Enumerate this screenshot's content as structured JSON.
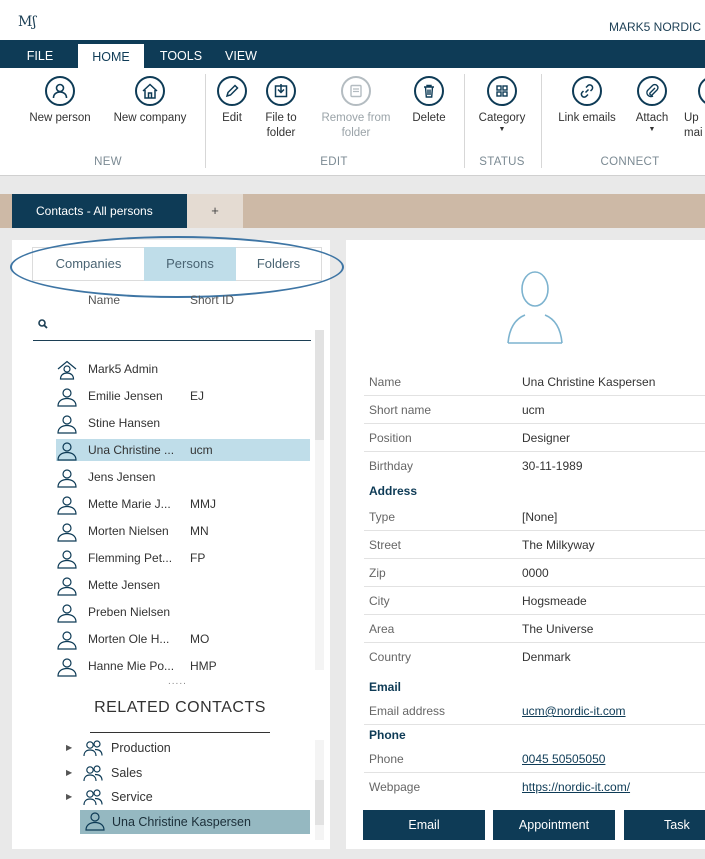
{
  "app": {
    "logo": "Mʃ",
    "title": "MARK5 NORDIC"
  },
  "ribbon_tabs": [
    "FILE",
    "HOME",
    "TOOLS",
    "VIEW"
  ],
  "ribbon": {
    "new_person": "New person",
    "new_company": "New company",
    "edit": "Edit",
    "file_to": "File to",
    "folder": "folder",
    "remove_from": "Remove from",
    "remove_folder": "folder",
    "delete": "Delete",
    "category": "Category",
    "link_emails": "Link emails",
    "attach": "Attach",
    "upload": "Up",
    "upload2": "mai",
    "groups": {
      "new": "NEW",
      "edit": "EDIT",
      "status": "STATUS",
      "connect": "CONNECT"
    }
  },
  "doc_tab": {
    "label": "Contacts - All persons",
    "plus": "+"
  },
  "left": {
    "tabs": [
      "Companies",
      "Persons",
      "Folders"
    ],
    "col_name": "Name",
    "col_short": "Short ID",
    "persons": [
      {
        "name": "Mark5 Admin",
        "id": "",
        "admin": true
      },
      {
        "name": "Emilie Jensen",
        "id": "EJ"
      },
      {
        "name": "Stine Hansen",
        "id": ""
      },
      {
        "name": "Una Christine ...",
        "id": "ucm",
        "selected": true
      },
      {
        "name": "Jens Jensen",
        "id": ""
      },
      {
        "name": "Mette Marie J...",
        "id": "MMJ"
      },
      {
        "name": "Morten Nielsen",
        "id": "MN"
      },
      {
        "name": "Flemming Pet...",
        "id": "FP"
      },
      {
        "name": "Mette Jensen",
        "id": ""
      },
      {
        "name": "Preben Nielsen",
        "id": ""
      },
      {
        "name": "Morten Ole H...",
        "id": "MO"
      },
      {
        "name": "Hanne Mie Po...",
        "id": "HMP"
      }
    ],
    "dots": ".....",
    "related_header": "RELATED CONTACTS",
    "related": [
      "Production",
      "Sales",
      "Service"
    ],
    "related_person": "Una Christine Kaspersen"
  },
  "detail": {
    "name_lbl": "Name",
    "name": "Una Christine Kaspersen",
    "short_lbl": "Short name",
    "short": "ucm",
    "position_lbl": "Position",
    "position": "Designer",
    "birthday_lbl": "Birthday",
    "birthday": "30-11-1989",
    "address_hdr": "Address",
    "type_lbl": "Type",
    "type": "[None]",
    "street_lbl": "Street",
    "street": "The Milkyway",
    "zip_lbl": "Zip",
    "zip": "0000",
    "city_lbl": "City",
    "city": "Hogsmeade",
    "area_lbl": "Area",
    "area": "The Universe",
    "country_lbl": "Country",
    "country": "Denmark",
    "email_hdr": "Email",
    "email_lbl": "Email address",
    "email": "ucm@nordic-it.com",
    "phone_hdr": "Phone",
    "phone_lbl": "Phone",
    "phone": "0045 50505050",
    "web_lbl": "Webpage",
    "web": "https://nordic-it.com/"
  },
  "actions": {
    "email": "Email",
    "appointment": "Appointment",
    "task": "Task"
  },
  "colors": {
    "navy": "#0e3b56",
    "selected": "#bfdde9",
    "tabbar": "#cdb9a6",
    "accent": "#3e75a4"
  }
}
